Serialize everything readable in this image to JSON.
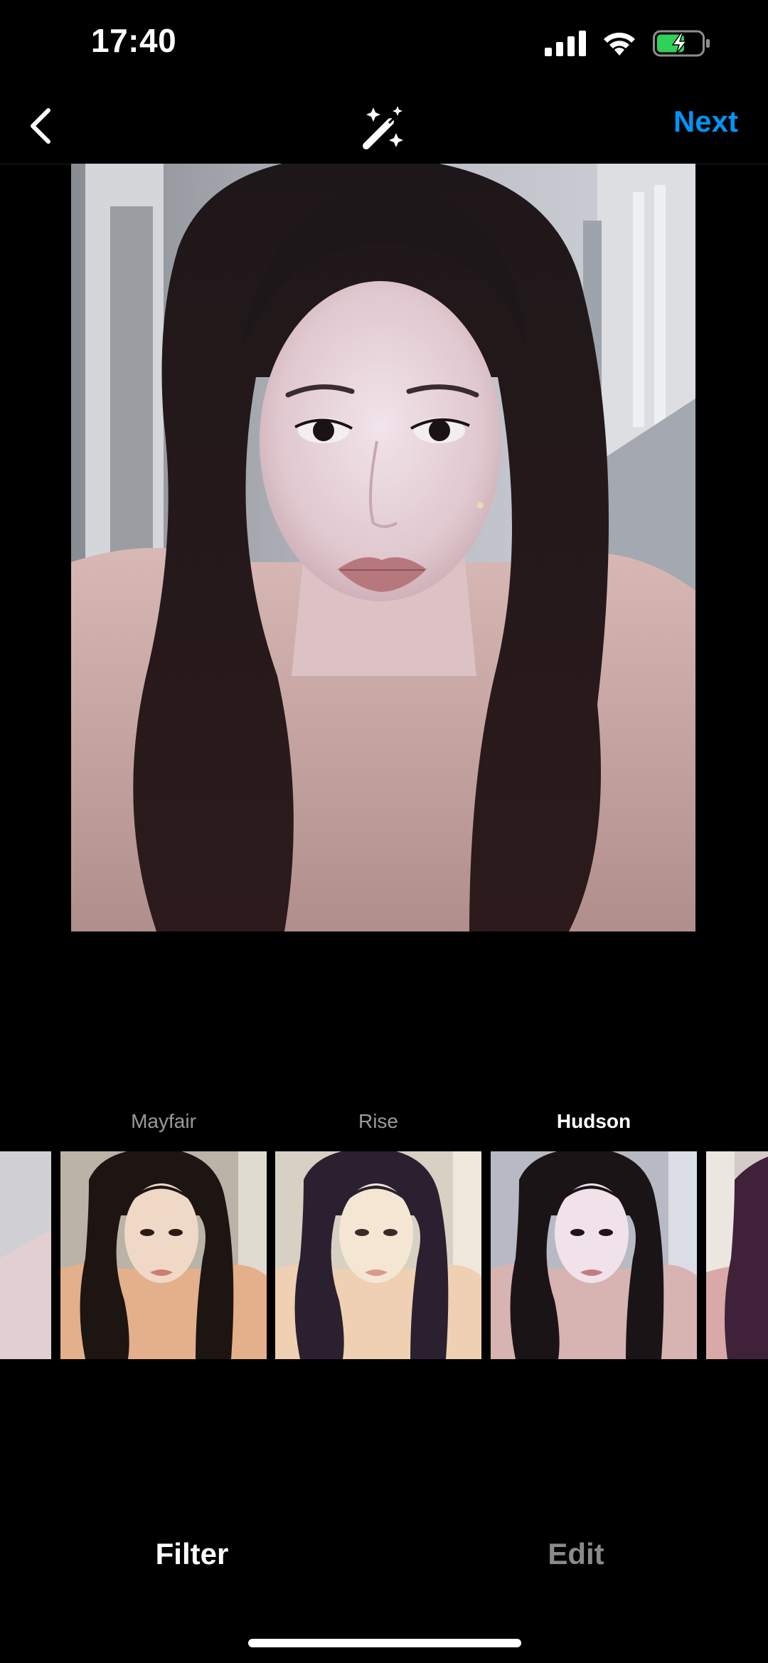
{
  "status_bar": {
    "time": "17:40",
    "icons": [
      "cellular-signal-icon",
      "wifi-icon",
      "battery-charging-icon"
    ]
  },
  "nav": {
    "back_icon": "chevron-left-icon",
    "magic_icon": "magic-wand-icon",
    "next_label": "Next"
  },
  "filters": {
    "items": [
      {
        "label": "",
        "visible_label": false
      },
      {
        "label": "Mayfair",
        "visible_label": true
      },
      {
        "label": "Rise",
        "visible_label": true
      },
      {
        "label": "Hudson",
        "visible_label": true,
        "selected": true
      },
      {
        "label": "",
        "visible_label": false
      }
    ]
  },
  "tabs": {
    "filter_label": "Filter",
    "edit_label": "Edit",
    "active": "Filter"
  },
  "colors": {
    "accent": "#0095f6",
    "background": "#000000",
    "inactive_text": "#8a8a8a"
  }
}
